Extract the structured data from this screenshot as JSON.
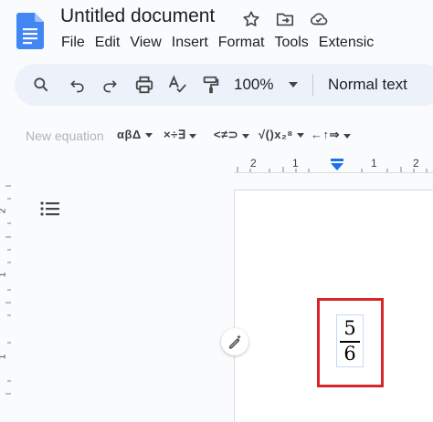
{
  "header": {
    "title": "Untitled document",
    "icons": [
      "star-icon",
      "move-to-folder-icon",
      "cloud-saved-icon"
    ]
  },
  "menu": [
    "File",
    "Edit",
    "View",
    "Insert",
    "Format",
    "Tools",
    "Extensic"
  ],
  "toolbar": {
    "zoom": "100%",
    "paragraph_style": "Normal text",
    "icons": [
      "search-icon",
      "undo-icon",
      "redo-icon",
      "print-icon",
      "spellcheck-icon",
      "paint-format-icon",
      "dropdown-caret-icon"
    ]
  },
  "equation_toolbar": {
    "new_equation": "New equation",
    "groups": [
      "αβΔ",
      "×÷∃",
      "<≠⊃",
      "√()x₂⁸",
      "←↑⇒"
    ]
  },
  "ruler": {
    "labels": [
      "2",
      "1",
      "1",
      "2"
    ],
    "vertical_labels": [
      "2",
      "1",
      "1"
    ]
  },
  "document": {
    "fraction": {
      "numerator": "5",
      "denominator": "6"
    }
  },
  "colors": {
    "highlight": "#d9252a",
    "docs_blue": "#4285f4",
    "toolbar_bg": "#edf2fa"
  }
}
